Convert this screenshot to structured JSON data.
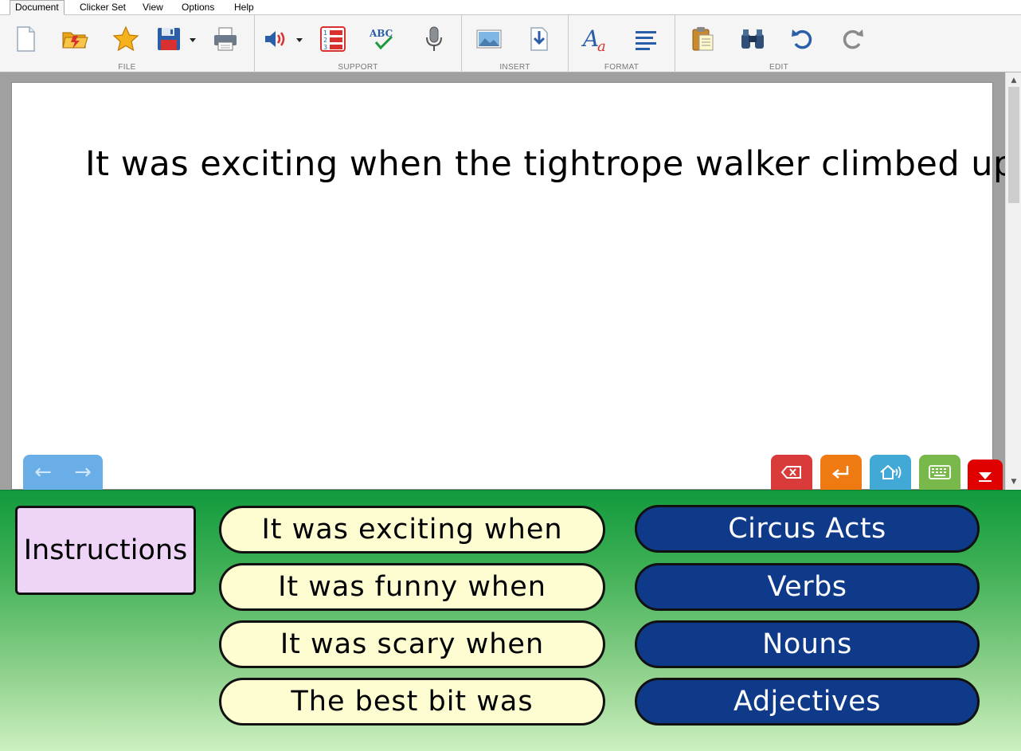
{
  "menu": {
    "items": [
      {
        "label": "Document",
        "active": true
      },
      {
        "label": "Clicker Set",
        "active": false
      },
      {
        "label": "View",
        "active": false
      },
      {
        "label": "Options",
        "active": false
      },
      {
        "label": "Help",
        "active": false
      }
    ]
  },
  "ribbon": {
    "groups": {
      "file": "FILE",
      "support": "SUPPORT",
      "insert": "INSERT",
      "format": "FORMAT",
      "edit": "EDIT"
    },
    "tools": [
      "new-document-icon",
      "open-folder-icon",
      "favourite-star-icon",
      "save-disk-icon",
      "print-icon",
      "speaker-icon",
      "numbered-list-icon",
      "spell-check-icon",
      "microphone-icon",
      "picture-icon",
      "insert-file-icon",
      "font-style-icon",
      "align-left-icon",
      "paste-clipboard-icon",
      "find-binoculars-icon",
      "undo-icon",
      "redo-icon"
    ]
  },
  "document": {
    "text": "It was exciting when the tightrope walker climbed up"
  },
  "controls": {
    "nav": [
      "←",
      "→"
    ],
    "colors": {
      "backspace": "#d93a3a",
      "enter": "#f07a12",
      "speak": "#42a8d6",
      "keyboard": "#79b84a",
      "collapse": "#e00000"
    }
  },
  "grid": {
    "instructions": "Instructions",
    "phrases": [
      "It was exciting when",
      "It was funny when",
      "It was scary when",
      "The best bit was"
    ],
    "categories": [
      "Circus Acts",
      "Verbs",
      "Nouns",
      "Adjectives"
    ],
    "colors": {
      "phrase_bg": "#fdfdd1",
      "category_bg": "#0f3a8a",
      "instructions_bg": "#eed5f7"
    }
  }
}
